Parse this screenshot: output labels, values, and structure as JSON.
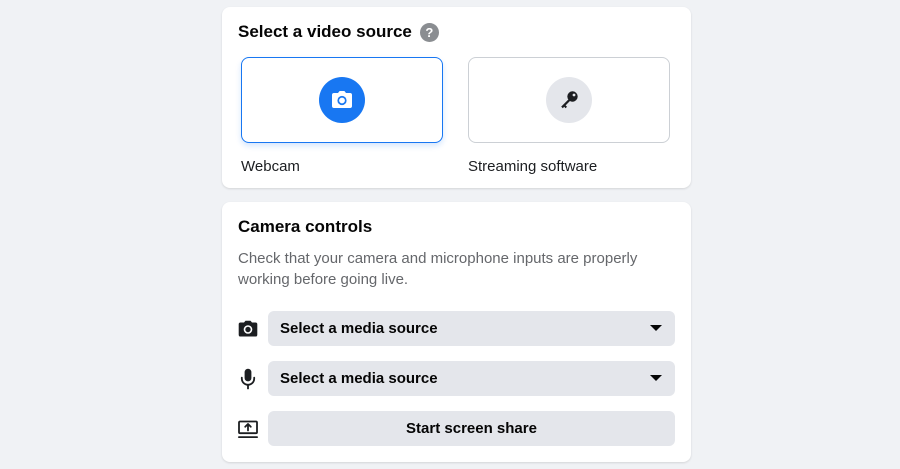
{
  "video_source": {
    "title": "Select a video source",
    "help_icon": "question-mark-icon",
    "help_glyph": "?",
    "options": [
      {
        "label": "Webcam",
        "icon": "camera-icon",
        "selected": true
      },
      {
        "label": "Streaming software",
        "icon": "key-icon",
        "selected": false
      }
    ]
  },
  "camera_controls": {
    "title": "Camera controls",
    "description": "Check that your camera and microphone inputs are properly working before going live.",
    "camera_select": {
      "icon": "camera-icon",
      "value": "Select a media source"
    },
    "microphone_select": {
      "icon": "microphone-icon",
      "value": "Select a media source"
    },
    "screen_share": {
      "icon": "screen-share-icon",
      "label": "Start screen share"
    }
  },
  "colors": {
    "accent": "#1877f2",
    "background": "#f0f2f5",
    "control_fill": "#e4e6eb",
    "secondary_text": "#65676b"
  }
}
